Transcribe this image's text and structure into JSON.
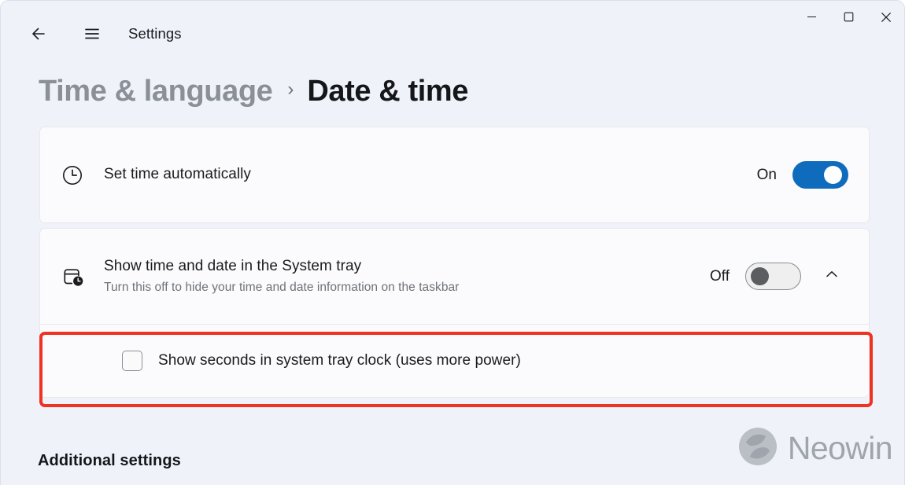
{
  "window": {
    "app_title": "Settings",
    "back_icon": "back-arrow-icon",
    "menu_icon": "hamburger-menu-icon",
    "minimize_icon": "minimize-icon",
    "maximize_icon": "maximize-icon",
    "close_icon": "close-icon"
  },
  "breadcrumb": {
    "parent": "Time & language",
    "separator": "›",
    "current": "Date & time"
  },
  "settings": {
    "set_time_automatically": {
      "icon": "clock-icon",
      "title": "Set time automatically",
      "toggle_label": "On",
      "toggle_state": "on"
    },
    "show_time_and_date": {
      "icon": "calendar-clock-icon",
      "title": "Show time and date in the System tray",
      "subtitle": "Turn this off to hide your time and date information on the taskbar",
      "toggle_label": "Off",
      "toggle_state": "off",
      "expander_icon": "chevron-up-icon",
      "expanded": true
    },
    "show_seconds": {
      "checkbox_label": "Show seconds in system tray clock (uses more power)",
      "checked": false,
      "highlight_color": "#ee3322"
    }
  },
  "footer": {
    "additional_settings": "Additional settings"
  },
  "watermark": {
    "logo_icon": "neowin-logo-icon",
    "text": "Neowin"
  },
  "colors": {
    "page_background": "#eff3f9",
    "card_background": "#fbfbfd",
    "accent": "#0f6cbd",
    "annotation_red": "#ee3322",
    "text_primary": "#1b1b1f",
    "text_secondary": "#6e7278"
  }
}
